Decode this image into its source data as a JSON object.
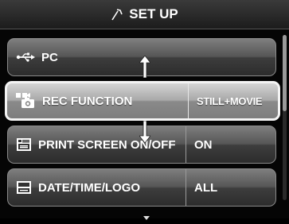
{
  "header": {
    "title": "SET UP",
    "icon": "wrench-icon"
  },
  "menu": {
    "items": [
      {
        "label": "PC",
        "value": "",
        "icon": "usb-icon"
      },
      {
        "label": "REC FUNCTION",
        "value": "STILL+MOVIE",
        "icon": "camera-movie-icon",
        "selected": true
      },
      {
        "label": "PRINT SCREEN ON/OFF",
        "value": "ON",
        "icon": "print-screen-icon"
      },
      {
        "label": "DATE/TIME/LOGO",
        "value": "ALL",
        "icon": "date-stamp-icon"
      }
    ]
  },
  "colors": {
    "highlight_border": "#f4f4f4",
    "row_dark": "#3d3d3d",
    "background": "#050505"
  }
}
